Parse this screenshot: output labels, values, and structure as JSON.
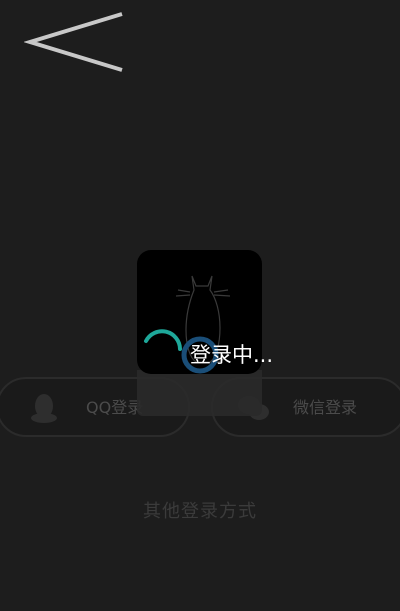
{
  "nav": {
    "back_icon": "chevron-left-icon"
  },
  "login_options": {
    "qq": {
      "label": "QQ登录",
      "icon": "qq-penguin-icon"
    },
    "wechat": {
      "label": "微信登录",
      "icon": "wechat-icon"
    }
  },
  "footer": {
    "other_methods": "其他登录方式"
  },
  "loading": {
    "text": "登录中...",
    "art_icon": "cat-illustration-icon",
    "spinner_icon": "spinner-icon"
  },
  "colors": {
    "background": "#1d1d1d",
    "overlay_card": "#000000",
    "spinner_teal": "#1ea89a",
    "spinner_blue": "#1a4e78",
    "muted_text": "#4b4b4b"
  }
}
